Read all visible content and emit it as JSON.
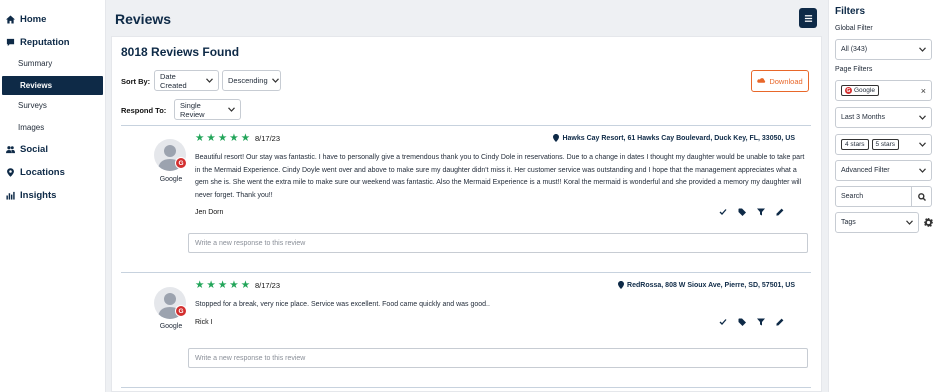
{
  "sidebar": {
    "items": [
      {
        "label": "Home",
        "icon": "home-icon"
      },
      {
        "label": "Reputation",
        "icon": "reputation-icon"
      },
      {
        "label": "Summary"
      },
      {
        "label": "Reviews",
        "active": true
      },
      {
        "label": "Surveys"
      },
      {
        "label": "Images"
      },
      {
        "label": "Social",
        "icon": "users-icon"
      },
      {
        "label": "Locations",
        "icon": "map-pin-icon"
      },
      {
        "label": "Insights",
        "icon": "chart-icon"
      }
    ]
  },
  "header": {
    "title": "Reviews"
  },
  "main": {
    "count": "8018 Reviews Found",
    "sort_label": "Sort By:",
    "sort_value": "Date Created",
    "order_value": "Descending",
    "respond_label": "Respond To:",
    "respond_value": "Single Review",
    "download_label": "Download",
    "reviews": [
      {
        "source": "Google",
        "stars": 5,
        "date": "8/17/23",
        "location": "Hawks Cay Resort, 61 Hawks Cay Boulevard, Duck Key, FL, 33050, US",
        "text": "Beautiful resort! Our stay was fantastic. I have to personally give a tremendous thank you to Cindy Dole in reservations. Due to a change in dates I thought my daughter would be unable to take part in the Mermaid Experience. Cindy Doyle went over and above to make sure my daughter didn't miss it. Her customer service was outstanding and I hope that the management appreciates what a gem she is. She went the extra mile to make sure our weekend was fantastic. Also the Mermaid Experience is a must!! Koral the mermaid is wonderful and she provided a memory my daughter will never forget. Thank you!!",
        "author": "Jen Dorn",
        "response_placeholder": "Write a new response to this review"
      },
      {
        "source": "Google",
        "stars": 5,
        "date": "8/17/23",
        "location": "RedRossa, 808 W Sioux Ave, Pierre, SD, 57501, US",
        "text": "Stopped for a break, very nice place. Service was excellent. Food came quickly and was good..",
        "author": "Rick I",
        "response_placeholder": "Write a new response to this review"
      }
    ]
  },
  "filters": {
    "title": "Filters",
    "global_label": "Global Filter",
    "global_value": "All (343)",
    "page_label": "Page Filters",
    "source_chip": "Google",
    "date_range": "Last 3 Months",
    "star_chips": [
      "4 stars",
      "5 stars"
    ],
    "advanced": "Advanced Filter",
    "search_placeholder": "Search",
    "tags": "Tags"
  },
  "colors": {
    "brand": "#0e2a47",
    "accent": "#e8672a",
    "star": "#22a559",
    "google": "#d32f2f"
  }
}
